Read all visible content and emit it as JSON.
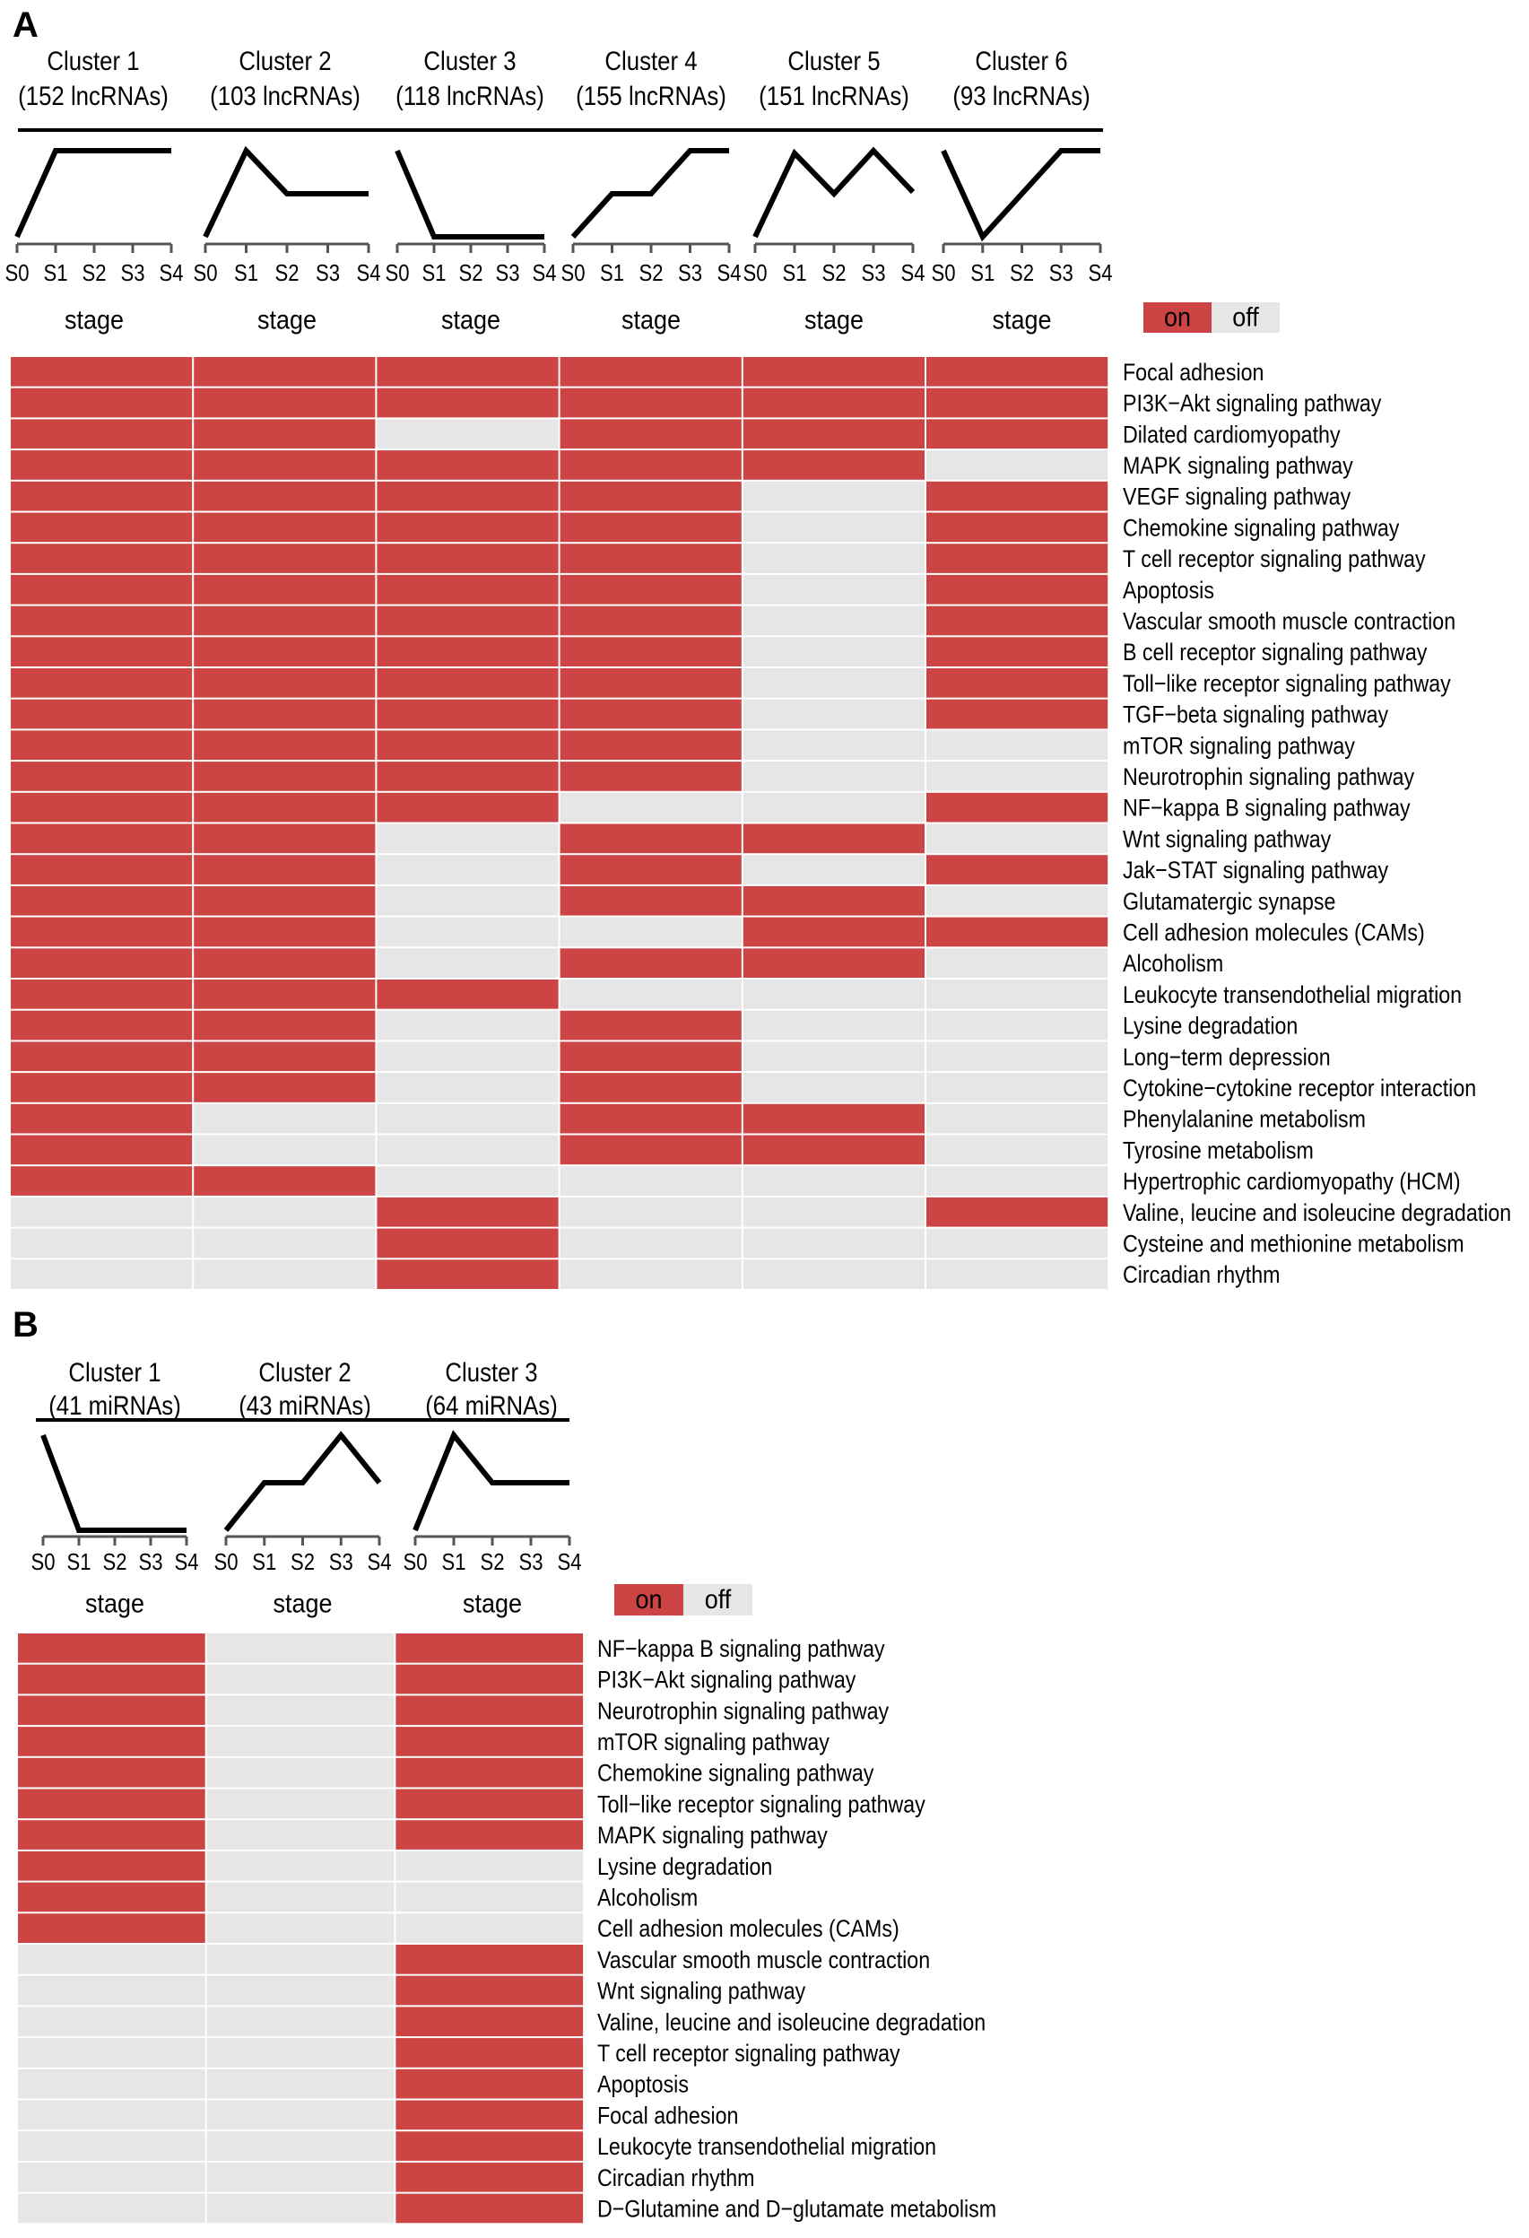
{
  "colors": {
    "on": "#cc4444",
    "off": "#e6e6e6",
    "line": "#000000",
    "axis": "#555555"
  },
  "chart_data": [
    {
      "type": "heatmap",
      "panel": "A",
      "title": "A",
      "stage_ticks": [
        "S0",
        "S1",
        "S2",
        "S3",
        "S4"
      ],
      "xlabel": "stage",
      "legend": {
        "on": "on",
        "off": "off",
        "placement": "top-right"
      },
      "clusters": [
        {
          "name": "Cluster 1",
          "count": "(152 lncRNAs)",
          "profile": [
            0,
            1,
            1,
            1,
            1
          ]
        },
        {
          "name": "Cluster 2",
          "count": "(103 lncRNAs)",
          "profile": [
            0,
            1,
            0.5,
            0.5,
            0.5
          ]
        },
        {
          "name": "Cluster 3",
          "count": "(118 lncRNAs)",
          "profile": [
            1,
            0,
            0,
            0,
            0
          ]
        },
        {
          "name": "Cluster 4",
          "count": "(155 lncRNAs)",
          "profile": [
            0,
            0.5,
            0.5,
            1,
            1
          ]
        },
        {
          "name": "Cluster 5",
          "count": "(151 lncRNAs)",
          "profile": [
            0,
            0.97,
            0.5,
            1,
            0.52
          ]
        },
        {
          "name": "Cluster 6",
          "count": "(93 lncRNAs)",
          "profile": [
            1,
            0,
            0.5,
            1,
            1
          ]
        }
      ],
      "rows": [
        {
          "pathway": "Focal adhesion",
          "values": [
            1,
            1,
            1,
            1,
            1,
            1
          ]
        },
        {
          "pathway": "PI3K−Akt signaling pathway",
          "values": [
            1,
            1,
            1,
            1,
            1,
            1
          ]
        },
        {
          "pathway": "Dilated cardiomyopathy",
          "values": [
            1,
            1,
            0,
            1,
            1,
            1
          ]
        },
        {
          "pathway": "MAPK signaling pathway",
          "values": [
            1,
            1,
            1,
            1,
            1,
            0
          ]
        },
        {
          "pathway": "VEGF signaling pathway",
          "values": [
            1,
            1,
            1,
            1,
            0,
            1
          ]
        },
        {
          "pathway": "Chemokine signaling pathway",
          "values": [
            1,
            1,
            1,
            1,
            0,
            1
          ]
        },
        {
          "pathway": "T cell receptor signaling pathway",
          "values": [
            1,
            1,
            1,
            1,
            0,
            1
          ]
        },
        {
          "pathway": "Apoptosis",
          "values": [
            1,
            1,
            1,
            1,
            0,
            1
          ]
        },
        {
          "pathway": "Vascular smooth muscle contraction",
          "values": [
            1,
            1,
            1,
            1,
            0,
            1
          ]
        },
        {
          "pathway": "B cell receptor signaling pathway",
          "values": [
            1,
            1,
            1,
            1,
            0,
            1
          ]
        },
        {
          "pathway": "Toll−like receptor signaling pathway",
          "values": [
            1,
            1,
            1,
            1,
            0,
            1
          ]
        },
        {
          "pathway": "TGF−beta signaling pathway",
          "values": [
            1,
            1,
            1,
            1,
            0,
            1
          ]
        },
        {
          "pathway": "mTOR signaling pathway",
          "values": [
            1,
            1,
            1,
            1,
            0,
            0
          ]
        },
        {
          "pathway": "Neurotrophin signaling pathway",
          "values": [
            1,
            1,
            1,
            1,
            0,
            0
          ]
        },
        {
          "pathway": "NF−kappa B signaling pathway",
          "values": [
            1,
            1,
            1,
            0,
            0,
            1
          ]
        },
        {
          "pathway": "Wnt signaling pathway",
          "values": [
            1,
            1,
            0,
            1,
            1,
            0
          ]
        },
        {
          "pathway": "Jak−STAT signaling pathway",
          "values": [
            1,
            1,
            0,
            1,
            0,
            1
          ]
        },
        {
          "pathway": "Glutamatergic synapse",
          "values": [
            1,
            1,
            0,
            1,
            1,
            0
          ]
        },
        {
          "pathway": "Cell adhesion molecules (CAMs)",
          "values": [
            1,
            1,
            0,
            0,
            1,
            1
          ]
        },
        {
          "pathway": "Alcoholism",
          "values": [
            1,
            1,
            0,
            1,
            1,
            0
          ]
        },
        {
          "pathway": "Leukocyte transendothelial migration",
          "values": [
            1,
            1,
            1,
            0,
            0,
            0
          ]
        },
        {
          "pathway": "Lysine degradation",
          "values": [
            1,
            1,
            0,
            1,
            0,
            0
          ]
        },
        {
          "pathway": "Long−term depression",
          "values": [
            1,
            1,
            0,
            1,
            0,
            0
          ]
        },
        {
          "pathway": "Cytokine−cytokine receptor interaction",
          "values": [
            1,
            1,
            0,
            1,
            0,
            0
          ]
        },
        {
          "pathway": "Phenylalanine metabolism",
          "values": [
            1,
            0,
            0,
            1,
            1,
            0
          ]
        },
        {
          "pathway": "Tyrosine metabolism",
          "values": [
            1,
            0,
            0,
            1,
            1,
            0
          ]
        },
        {
          "pathway": "Hypertrophic cardiomyopathy (HCM)",
          "values": [
            1,
            1,
            0,
            0,
            0,
            0
          ]
        },
        {
          "pathway": "Valine, leucine and isoleucine degradation",
          "values": [
            0,
            0,
            1,
            0,
            0,
            1
          ]
        },
        {
          "pathway": "Cysteine and methionine metabolism",
          "values": [
            0,
            0,
            1,
            0,
            0,
            0
          ]
        },
        {
          "pathway": "Circadian rhythm",
          "values": [
            0,
            0,
            1,
            0,
            0,
            0
          ]
        }
      ]
    },
    {
      "type": "heatmap",
      "panel": "B",
      "title": "B",
      "stage_ticks": [
        "S0",
        "S1",
        "S2",
        "S3",
        "S4"
      ],
      "xlabel": "stage",
      "legend": {
        "on": "on",
        "off": "off",
        "placement": "top-right"
      },
      "clusters": [
        {
          "name": "Cluster 1",
          "count": "(41 miRNAs)",
          "profile": [
            1,
            0,
            0,
            0,
            0
          ]
        },
        {
          "name": "Cluster 2",
          "count": "(43 miRNAs)",
          "profile": [
            0,
            0.5,
            0.5,
            1,
            0.5
          ]
        },
        {
          "name": "Cluster 3",
          "count": "(64 miRNAs)",
          "profile": [
            0,
            1,
            0.5,
            0.5,
            0.5
          ]
        }
      ],
      "rows": [
        {
          "pathway": "NF−kappa B signaling pathway",
          "values": [
            1,
            0,
            1
          ]
        },
        {
          "pathway": "PI3K−Akt signaling pathway",
          "values": [
            1,
            0,
            1
          ]
        },
        {
          "pathway": "Neurotrophin signaling pathway",
          "values": [
            1,
            0,
            1
          ]
        },
        {
          "pathway": "mTOR signaling pathway",
          "values": [
            1,
            0,
            1
          ]
        },
        {
          "pathway": "Chemokine signaling pathway",
          "values": [
            1,
            0,
            1
          ]
        },
        {
          "pathway": "Toll−like receptor signaling pathway",
          "values": [
            1,
            0,
            1
          ]
        },
        {
          "pathway": "MAPK signaling pathway",
          "values": [
            1,
            0,
            1
          ]
        },
        {
          "pathway": "Lysine degradation",
          "values": [
            1,
            0,
            0
          ]
        },
        {
          "pathway": "Alcoholism",
          "values": [
            1,
            0,
            0
          ]
        },
        {
          "pathway": "Cell adhesion molecules (CAMs)",
          "values": [
            1,
            0,
            0
          ]
        },
        {
          "pathway": "Vascular smooth muscle contraction",
          "values": [
            0,
            0,
            1
          ]
        },
        {
          "pathway": "Wnt signaling pathway",
          "values": [
            0,
            0,
            1
          ]
        },
        {
          "pathway": "Valine, leucine and isoleucine degradation",
          "values": [
            0,
            0,
            1
          ]
        },
        {
          "pathway": "T cell receptor signaling pathway",
          "values": [
            0,
            0,
            1
          ]
        },
        {
          "pathway": "Apoptosis",
          "values": [
            0,
            0,
            1
          ]
        },
        {
          "pathway": "Focal adhesion",
          "values": [
            0,
            0,
            1
          ]
        },
        {
          "pathway": "Leukocyte transendothelial migration",
          "values": [
            0,
            0,
            1
          ]
        },
        {
          "pathway": "Circadian rhythm",
          "values": [
            0,
            0,
            1
          ]
        },
        {
          "pathway": "D−Glutamine and D−glutamate metabolism",
          "values": [
            0,
            0,
            1
          ]
        }
      ]
    }
  ]
}
